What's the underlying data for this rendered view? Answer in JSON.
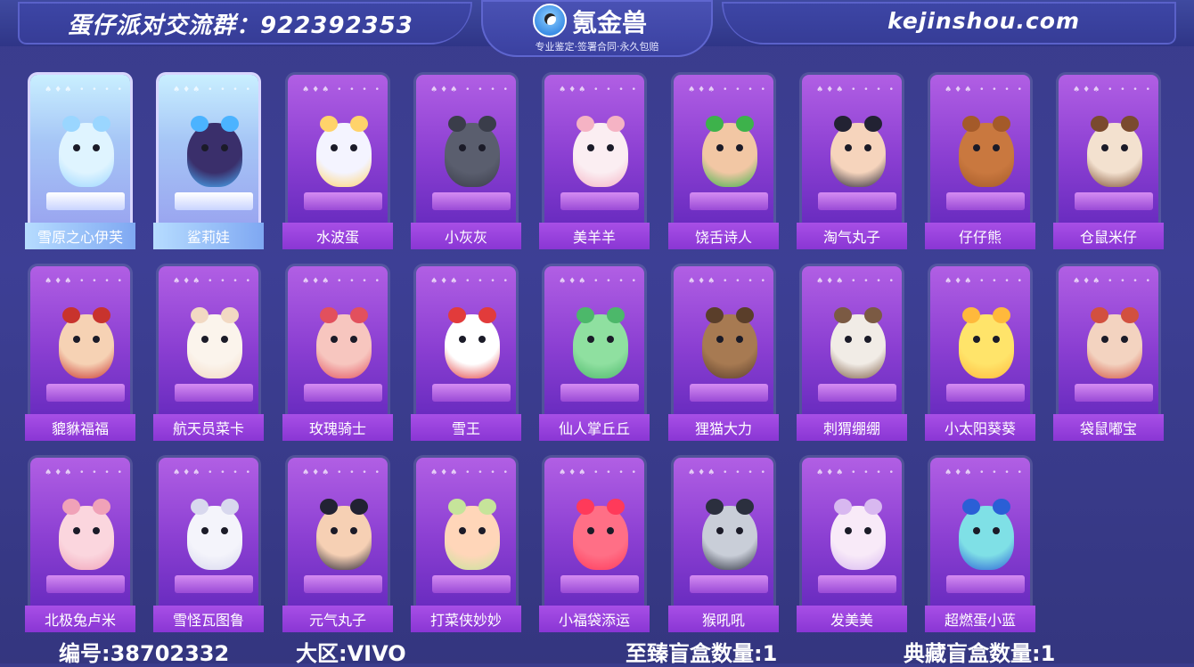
{
  "header": {
    "group_text": "蛋仔派对交流群：922392353",
    "site": "kejinshou.com",
    "logo_name": "氪金兽",
    "logo_slogan": "专业鉴定·签署合同·永久包赔"
  },
  "cards": [
    {
      "name": "雪原之心伊芙",
      "special": true,
      "color": "#dff4ff",
      "accent": "#9ad6ff"
    },
    {
      "name": "鲨莉娃",
      "special": true,
      "color": "#3a2f6b",
      "accent": "#4bb3ff"
    },
    {
      "name": "水波蛋",
      "special": false,
      "color": "#f4f4ff",
      "accent": "#ffd36a"
    },
    {
      "name": "小灰灰",
      "special": false,
      "color": "#5a5e6e",
      "accent": "#3a3d4a"
    },
    {
      "name": "美羊羊",
      "special": false,
      "color": "#fbeef2",
      "accent": "#f5b3c4"
    },
    {
      "name": "饶舌诗人",
      "special": false,
      "color": "#f2c7a4",
      "accent": "#3db24b"
    },
    {
      "name": "淘气丸子",
      "special": false,
      "color": "#f6d4bc",
      "accent": "#222233"
    },
    {
      "name": "仔仔熊",
      "special": false,
      "color": "#c9783f",
      "accent": "#a45a29"
    },
    {
      "name": "仓鼠米仔",
      "special": false,
      "color": "#f3e1cf",
      "accent": "#7a4a2e"
    },
    {
      "name": "貔貅福福",
      "special": false,
      "color": "#f6d2b4",
      "accent": "#c8332d"
    },
    {
      "name": "航天员菜卡",
      "special": false,
      "color": "#fbf4ec",
      "accent": "#f2d9c3"
    },
    {
      "name": "玫瑰骑士",
      "special": false,
      "color": "#f7c6bf",
      "accent": "#e2505d"
    },
    {
      "name": "雪王",
      "special": false,
      "color": "#ffffff",
      "accent": "#e23b3b"
    },
    {
      "name": "仙人掌丘丘",
      "special": false,
      "color": "#8fe0a0",
      "accent": "#4cb86a"
    },
    {
      "name": "狸猫大力",
      "special": false,
      "color": "#a77a52",
      "accent": "#5a3e2a"
    },
    {
      "name": "刺猬绷绷",
      "special": false,
      "color": "#f1ece6",
      "accent": "#7b5a43"
    },
    {
      "name": "小太阳葵葵",
      "special": false,
      "color": "#ffe46a",
      "accent": "#ffb93c"
    },
    {
      "name": "袋鼠嘟宝",
      "special": false,
      "color": "#f3d3c0",
      "accent": "#d2503f"
    },
    {
      "name": "北极兔卢米",
      "special": false,
      "color": "#fbd6de",
      "accent": "#f0a2b8"
    },
    {
      "name": "雪怪瓦图鲁",
      "special": false,
      "color": "#f4f4fb",
      "accent": "#d8d8ee"
    },
    {
      "name": "元气丸子",
      "special": false,
      "color": "#f6d0b4",
      "accent": "#222233"
    },
    {
      "name": "打菜侠妙妙",
      "special": false,
      "color": "#ffd6b9",
      "accent": "#c6e49a"
    },
    {
      "name": "小福袋添运",
      "special": false,
      "color": "#ff6f86",
      "accent": "#ff3a5a"
    },
    {
      "name": "猴吼吼",
      "special": false,
      "color": "#c9ced8",
      "accent": "#2b2f3e"
    },
    {
      "name": "发美美",
      "special": false,
      "color": "#f8eaf8",
      "accent": "#d8b8f0"
    },
    {
      "name": "超燃蛋小蓝",
      "special": false,
      "color": "#7fe0e6",
      "accent": "#2a5fd6"
    }
  ],
  "footer": {
    "id_text": "编号:38702332",
    "region_text": "大区:VIVO",
    "box1_text": "至臻盲盒数量:1",
    "box2_text": "典藏盲盒数量:1"
  }
}
